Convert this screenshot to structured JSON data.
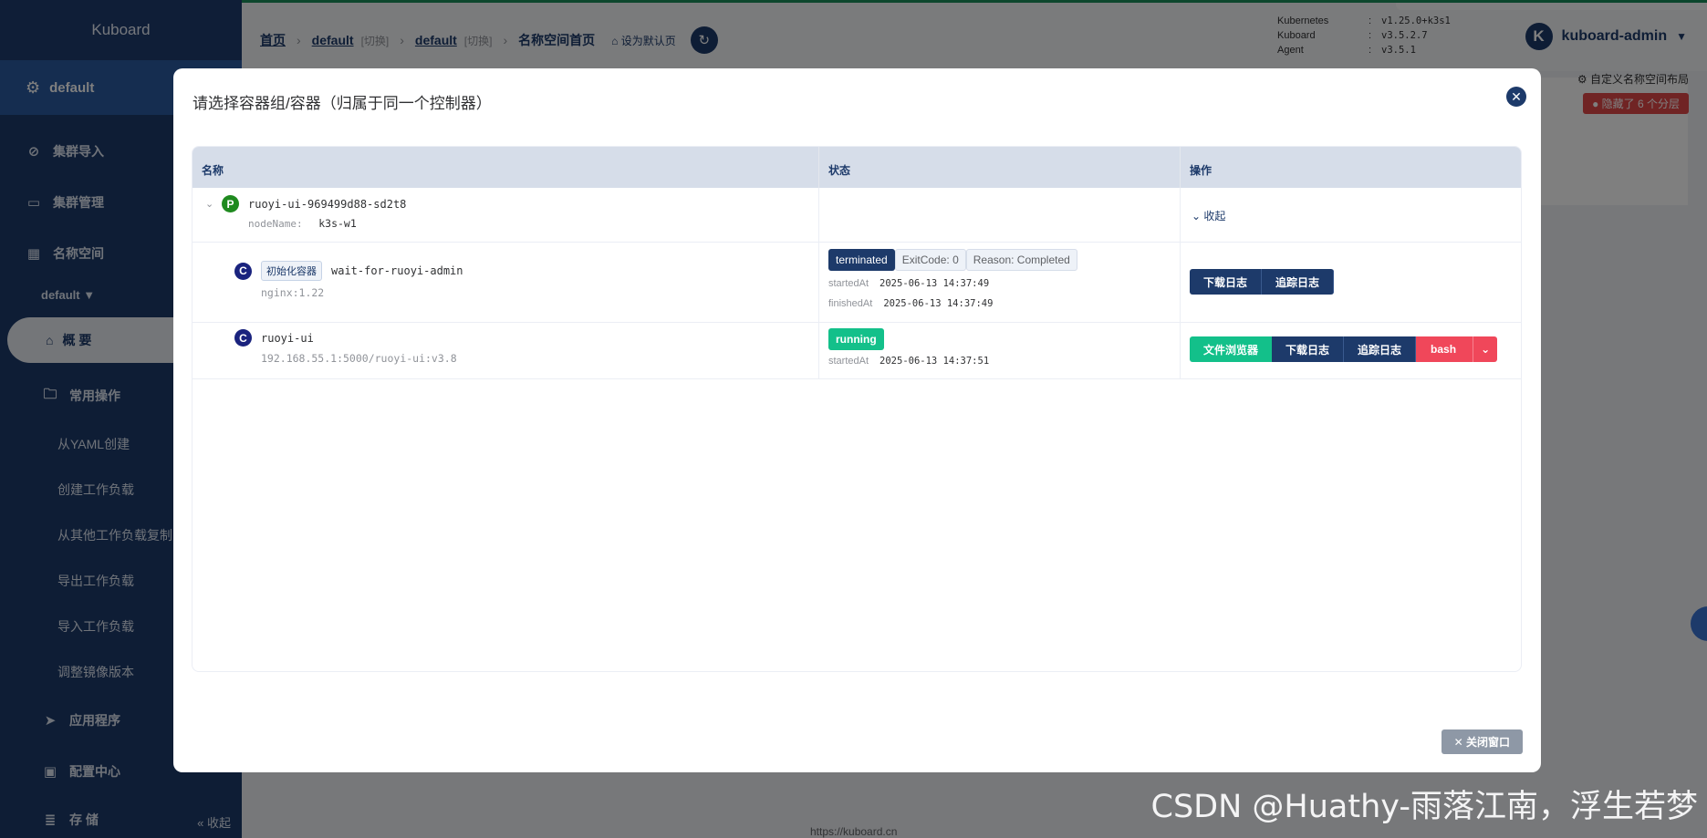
{
  "sidebar": {
    "logo": "Kuboard",
    "cluster": "default",
    "items": [
      {
        "label": "集群导入",
        "icon": "link-icon"
      },
      {
        "label": "集群管理",
        "icon": "archive-icon"
      },
      {
        "label": "名称空间",
        "icon": "grid-icon"
      }
    ],
    "namespace": "default",
    "overview": "概 要",
    "common_ops": "常用操作",
    "sub_items": [
      "从YAML创建",
      "创建工作负载",
      "从其他工作负载复制",
      "导出工作负载",
      "导入工作负载",
      "调整镜像版本"
    ],
    "apps": "应用程序",
    "config": "配置中心",
    "storage": "存 储",
    "collapse": "收起"
  },
  "header": {
    "breadcrumb": {
      "home": "首页",
      "cluster": "default",
      "cluster_switch": "[切换]",
      "namespace": "default",
      "namespace_switch": "[切换]",
      "current": "名称空间首页",
      "set_default": "设为默认页"
    },
    "versions": [
      {
        "key": "Kubernetes",
        "value": "v1.25.0+k3s1"
      },
      {
        "key": "Kuboard",
        "value": "v3.5.2.7"
      },
      {
        "key": "Agent",
        "value": "v3.5.1"
      }
    ],
    "user": {
      "avatar_letter": "K",
      "name": "kuboard-admin"
    }
  },
  "page": {
    "layout_link": "自定义名称空间布局",
    "hidden_layers": "隐藏了 6 个分层",
    "footer_link": "https://kuboard.cn"
  },
  "dialog": {
    "title": "请选择容器组/容器（归属于同一个控制器）",
    "columns": [
      "名称",
      "状态",
      "操作"
    ],
    "pod": {
      "badge": "P",
      "name": "ruoyi-ui-969499d88-sd2t8",
      "node_label": "nodeName:",
      "node_value": "k3s-w1",
      "collapse": "收起"
    },
    "init_container": {
      "badge": "C",
      "tag": "初始化容器",
      "name": "wait-for-ruoyi-admin",
      "image": "nginx:1.22",
      "state": "terminated",
      "exit_code": "ExitCode: 0",
      "reason": "Reason: Completed",
      "started_label": "startedAt",
      "started_value": "2025-06-13 14:37:49",
      "finished_label": "finishedAt",
      "finished_value": "2025-06-13 14:37:49",
      "actions": [
        "下载日志",
        "追踪日志"
      ]
    },
    "container": {
      "badge": "C",
      "name": "ruoyi-ui",
      "image": "192.168.55.1:5000/ruoyi-ui:v3.8",
      "state": "running",
      "started_label": "startedAt",
      "started_value": "2025-06-13 14:37:51",
      "actions": [
        "文件浏览器",
        "下载日志",
        "追踪日志",
        "bash"
      ]
    },
    "close_button": "关闭窗口"
  },
  "watermark": "CSDN @Huathy-雨落江南，浮生若梦"
}
